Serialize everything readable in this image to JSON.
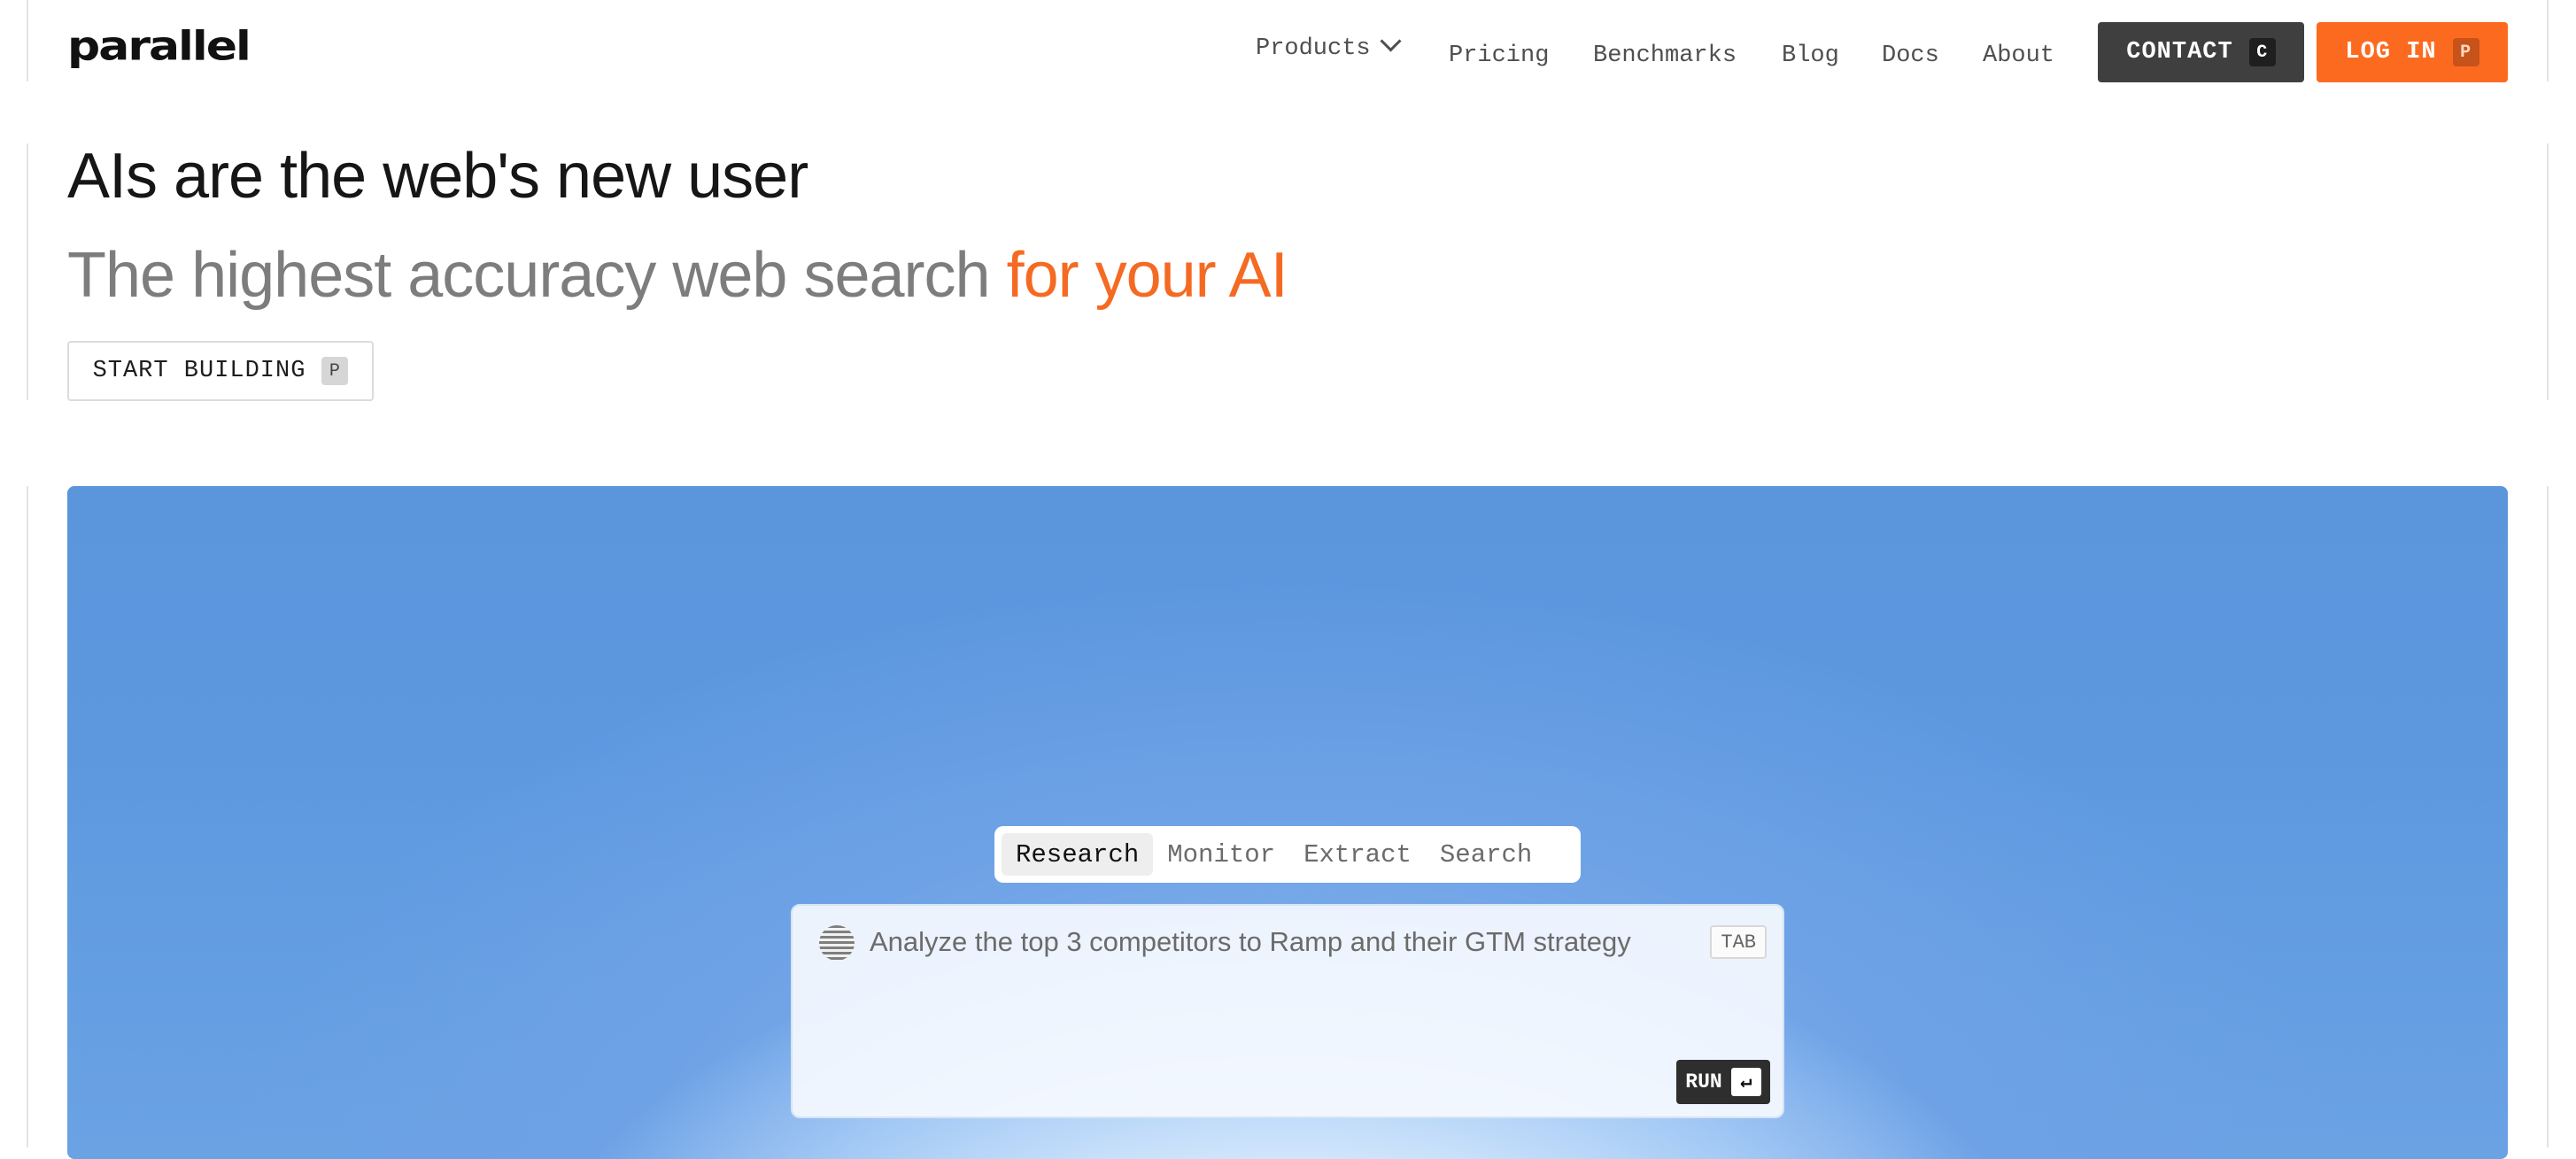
{
  "brand": {
    "logo": "parallel"
  },
  "nav": {
    "products": "Products",
    "pricing": "Pricing",
    "benchmarks": "Benchmarks",
    "blog": "Blog",
    "docs": "Docs",
    "about": "About",
    "contact": {
      "label": "CONTACT",
      "shortcut": "C"
    },
    "login": {
      "label": "LOG IN",
      "shortcut": "P"
    }
  },
  "hero": {
    "headline": "AIs are the web's new user",
    "subline_main": "The highest accuracy web search ",
    "subline_accent": "for your AI",
    "start_button": {
      "label": "START BUILDING",
      "shortcut": "P"
    }
  },
  "demo": {
    "tabs": [
      "Research",
      "Monitor",
      "Extract",
      "Search"
    ],
    "active_tab": "Research",
    "prompt_placeholder": "Analyze the top 3 competitors to Ramp and their GTM strategy",
    "tab_key": "TAB",
    "run_label": "RUN",
    "enter_symbol": "↵"
  },
  "colors": {
    "accent": "#f56a22",
    "login_bg": "#fc6a1f",
    "contact_bg": "#3f3f3f",
    "sky": "#5b95dc"
  }
}
